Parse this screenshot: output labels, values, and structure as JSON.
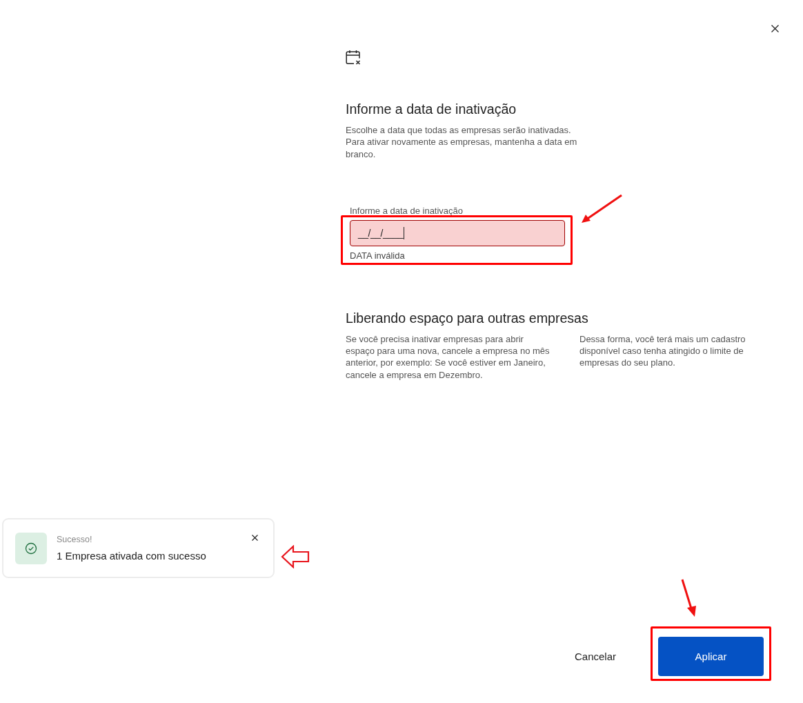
{
  "dialog": {
    "title": "Informe a data de inativação",
    "description": "Escolhe a data que todas as empresas serão inativadas. Para ativar novamente as empresas, mantenha a data em branco."
  },
  "date_field": {
    "label": "Informe a data de inativação",
    "value": "__/__/____",
    "focused": true,
    "invalid": true,
    "error": "DATA inválida",
    "highlighted": true
  },
  "info": {
    "title": "Liberando espaço para outras empresas",
    "paragraphs": [
      "Se você precisa inativar empresas para abrir\nespaço para uma nova, cancele a empresa no mês anterior, por exemplo: Se você estiver em Janeiro, cancele a empresa em Dezembro.",
      "Dessa forma, você terá mais um cadastro disponível caso tenha atingido o limite de empresas do seu plano."
    ]
  },
  "footer": {
    "buttons": [
      {
        "label": "Cancelar",
        "kind": "text",
        "highlighted": false
      },
      {
        "label": "Aplicar",
        "kind": "primary",
        "highlighted": true
      }
    ]
  },
  "toast": {
    "kind": "success",
    "title": "Sucesso!",
    "message": "1 Empresa ativada com sucesso",
    "pointed_at": true
  }
}
